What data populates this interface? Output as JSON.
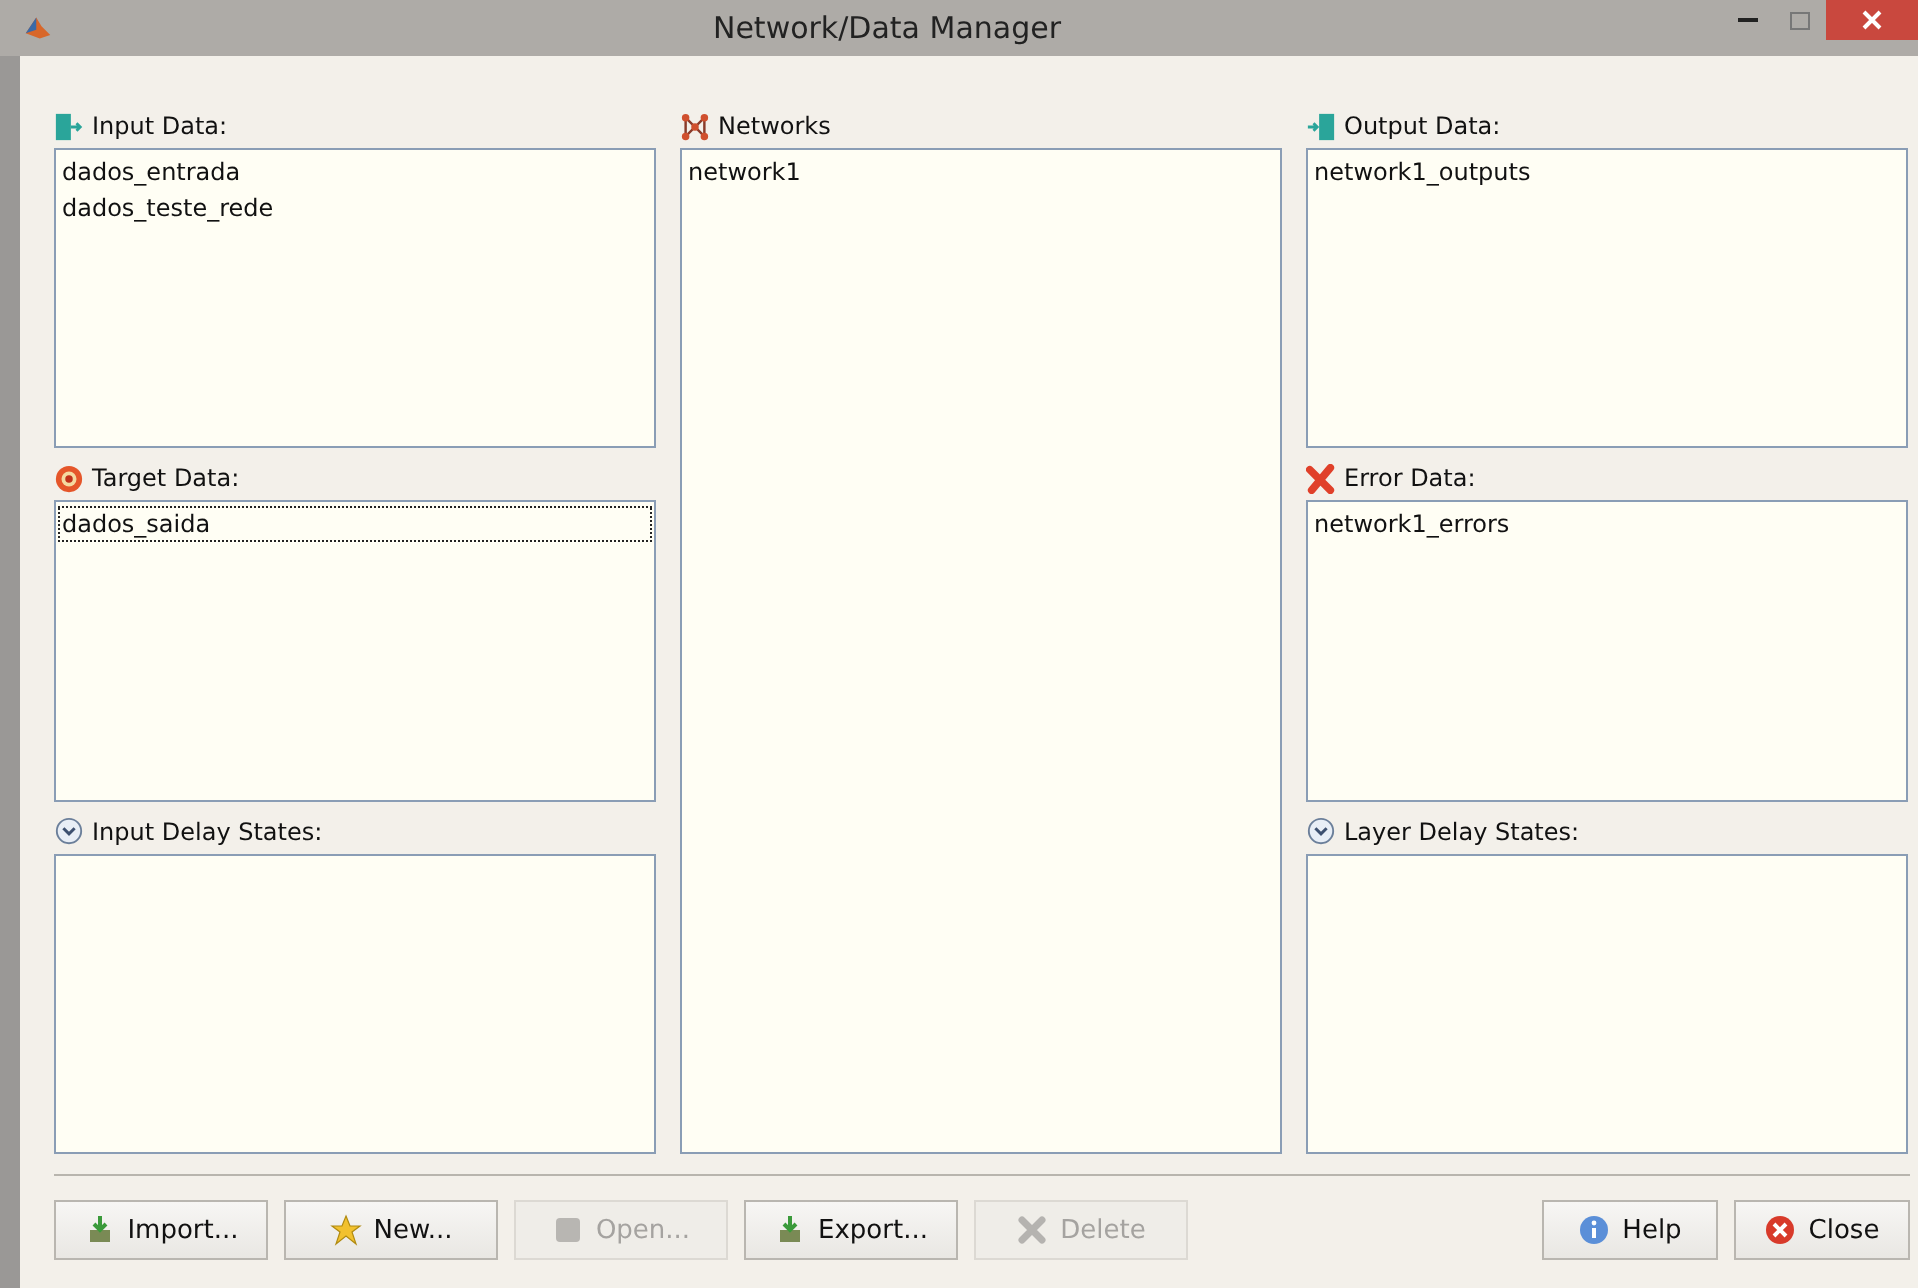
{
  "window": {
    "title": "Network/Data Manager"
  },
  "columns": [
    [
      {
        "label": "Input Data:",
        "kind": "input",
        "items": [
          {
            "text": "dados_entrada",
            "selected": false
          },
          {
            "text": "dados_teste_rede",
            "selected": false
          }
        ]
      },
      {
        "label": "Target Data:",
        "kind": "target",
        "items": [
          {
            "text": "dados_saida",
            "selected": true
          }
        ]
      },
      {
        "label": "Input Delay States:",
        "kind": "delay"
      }
    ],
    [
      {
        "label": "Networks",
        "kind": "network",
        "items": [
          {
            "text": "network1",
            "selected": false
          }
        ]
      }
    ],
    [
      {
        "label": "Output Data:",
        "kind": "output",
        "items": [
          {
            "text": "network1_outputs",
            "selected": false
          }
        ]
      },
      {
        "label": "Error Data:",
        "kind": "error",
        "items": [
          {
            "text": "network1_errors",
            "selected": false
          }
        ]
      },
      {
        "label": "Layer Delay States:",
        "kind": "delay"
      }
    ]
  ],
  "buttons_left": [
    {
      "label": "Import...",
      "kind": "import",
      "disabled": false
    },
    {
      "label": "New...",
      "kind": "new",
      "disabled": false
    },
    {
      "label": "Open...",
      "kind": "open",
      "disabled": true
    },
    {
      "label": "Export...",
      "kind": "import",
      "disabled": false
    },
    {
      "label": "Delete",
      "kind": "delete",
      "disabled": true
    }
  ],
  "buttons_right": [
    {
      "label": "Help",
      "kind": "help",
      "disabled": false
    },
    {
      "label": "Close",
      "kind": "close",
      "disabled": false
    }
  ]
}
